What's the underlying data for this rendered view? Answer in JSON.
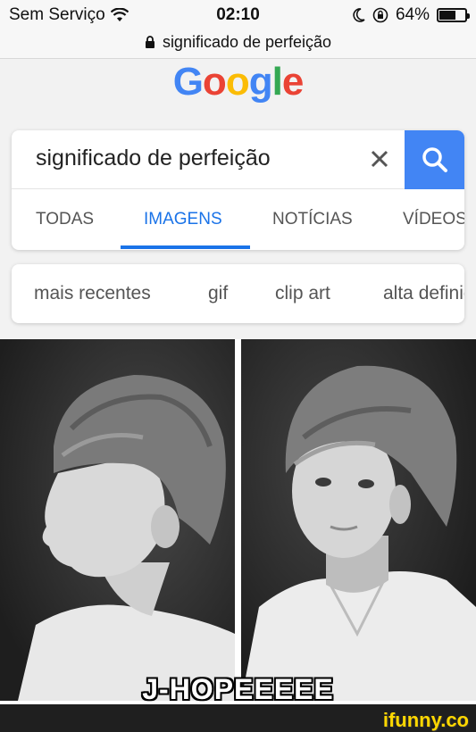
{
  "status_bar": {
    "carrier": "Sem Serviço",
    "time": "02:10",
    "battery": "64%",
    "battery_level": 0.64,
    "icons": [
      "wifi-icon",
      "moon-icon",
      "rotation-lock-icon",
      "battery-icon"
    ]
  },
  "url_bar": {
    "text": "significado de perfeição",
    "icon": "lock-icon"
  },
  "logo": {
    "letters": [
      "G",
      "o",
      "o",
      "g",
      "l",
      "e"
    ],
    "colors": [
      "#4285f4",
      "#ea4335",
      "#fbbc05",
      "#4285f4",
      "#34a853",
      "#ea4335"
    ]
  },
  "search": {
    "query": "significado de perfeição",
    "clear_icon": "close-icon",
    "button_icon": "search-icon",
    "button_color": "#4285f4"
  },
  "tabs": [
    {
      "label": "TODAS",
      "active": false
    },
    {
      "label": "IMAGENS",
      "active": true
    },
    {
      "label": "NOTÍCIAS",
      "active": false
    },
    {
      "label": "VÍDEOS",
      "active": false
    }
  ],
  "filters": [
    "mais recentes",
    "gif",
    "clip art",
    "alta definição"
  ],
  "caption": "J-HOPEEEEE",
  "watermark": "ifunny.co"
}
